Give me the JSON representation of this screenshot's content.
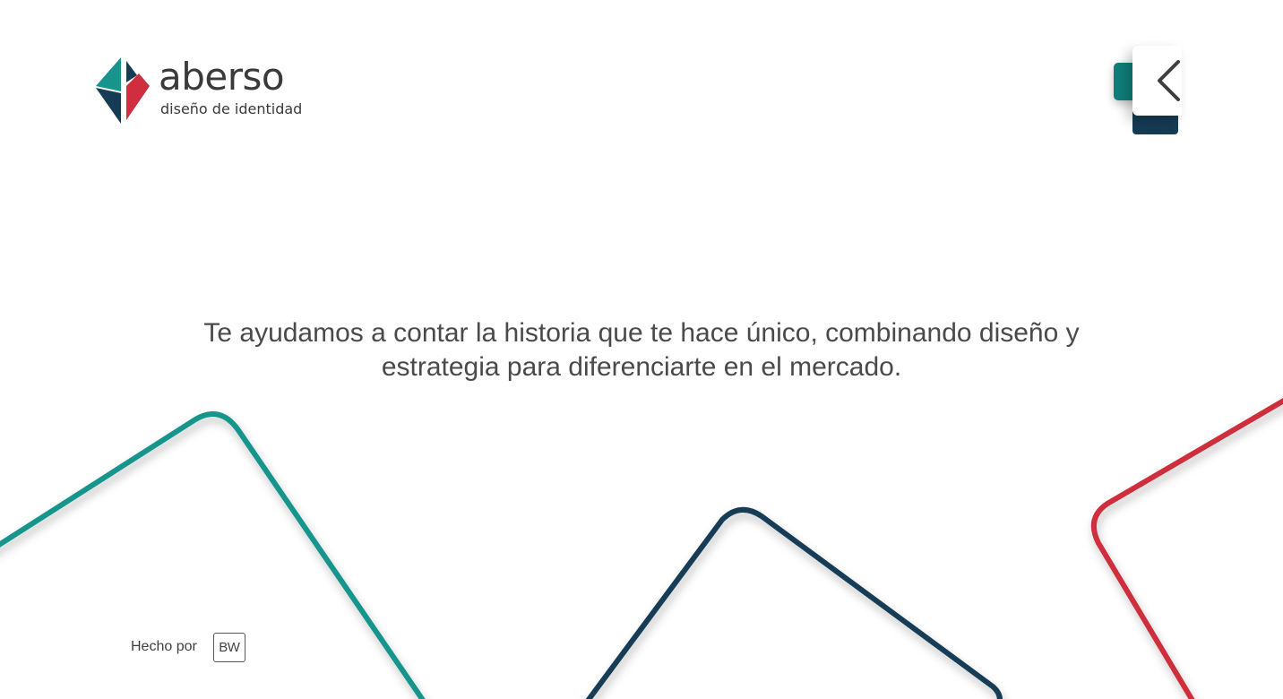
{
  "brand": {
    "name": "aberso",
    "tagline": "diseño de identidad"
  },
  "menu": {
    "icon": "chevron-left-icon"
  },
  "hero": {
    "line1": "Te ayudamos a contar la historia que te hace único, combinando diseño y",
    "line2": "estrategia para diferenciarte en el mercado."
  },
  "footer": {
    "credit_label": "Hecho por",
    "credit_badge": "BW"
  },
  "colors": {
    "teal": "#17958c",
    "navy": "#153c54",
    "red": "#cf2e3e",
    "text": "#4a4a4c"
  }
}
